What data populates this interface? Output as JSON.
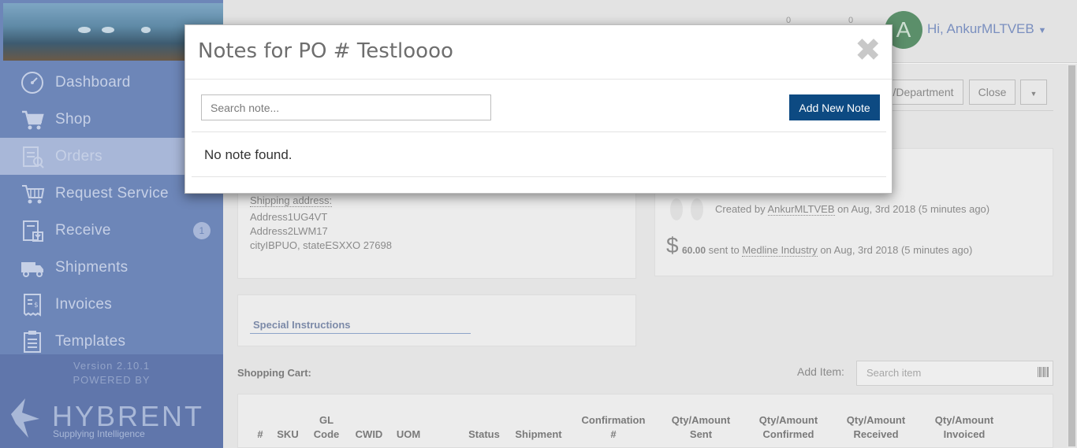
{
  "sidebar": {
    "items": [
      {
        "label": "Dashboard",
        "icon": "dashboard-icon"
      },
      {
        "label": "Shop",
        "icon": "cart-icon"
      },
      {
        "label": "Orders",
        "icon": "orders-icon",
        "active": true
      },
      {
        "label": "Request Service",
        "icon": "request-service-icon"
      },
      {
        "label": "Receive",
        "icon": "receive-icon",
        "badge": "1"
      },
      {
        "label": "Shipments",
        "icon": "truck-icon"
      },
      {
        "label": "Invoices",
        "icon": "invoice-icon"
      },
      {
        "label": "Templates",
        "icon": "templates-icon"
      }
    ],
    "version": "Version 2.10.1",
    "powered_by": "POWERED BY",
    "brand": "HYBRENT",
    "tagline": "Supplying Intelligence"
  },
  "topbar": {
    "avatar_letter": "A",
    "greeting": "Hi, AnkurMLTVEB",
    "counts": [
      "0",
      "0"
    ]
  },
  "toolbar": {
    "department_label": "/Department",
    "close_label": "Close"
  },
  "shipping": {
    "heading": "Shipping address:",
    "line1": "Address1UG4VT",
    "line2": "Address2LWM17",
    "line3": "cityIBPUO, stateESXXO 27698"
  },
  "activity": {
    "created_prefix": "Created by",
    "created_user": "AnkurMLTVEB",
    "created_suffix": "on Aug, 3rd 2018 (5 minutes ago)",
    "amount": "60.00",
    "sent_prefix": "sent to",
    "vendor": "Medline Industry",
    "sent_suffix": "on Aug, 3rd 2018 (5 minutes ago)"
  },
  "special_instructions": "Special Instructions",
  "cart": {
    "label": "Shopping Cart:",
    "add_item_label": "Add Item:",
    "search_placeholder": "Search item",
    "columns": [
      "#",
      "SKU",
      "GL Code",
      "CWID",
      "UOM",
      "Status",
      "Shipment",
      "Confirmation #",
      "Qty/Amount Sent",
      "Qty/Amount Confirmed",
      "Qty/Amount Received",
      "Qty/Amount Invoiced"
    ]
  },
  "modal": {
    "title": "Notes for PO # Testloooo",
    "close_symbol": "✖",
    "search_placeholder": "Search note...",
    "add_button": "Add New Note",
    "empty_message": "No note found."
  },
  "colors": {
    "sidebar_bg": "#6d86b8",
    "sidebar_active": "#a8b7d8",
    "primary_button": "#0d4a82",
    "avatar_bg": "#5b8f6a"
  }
}
